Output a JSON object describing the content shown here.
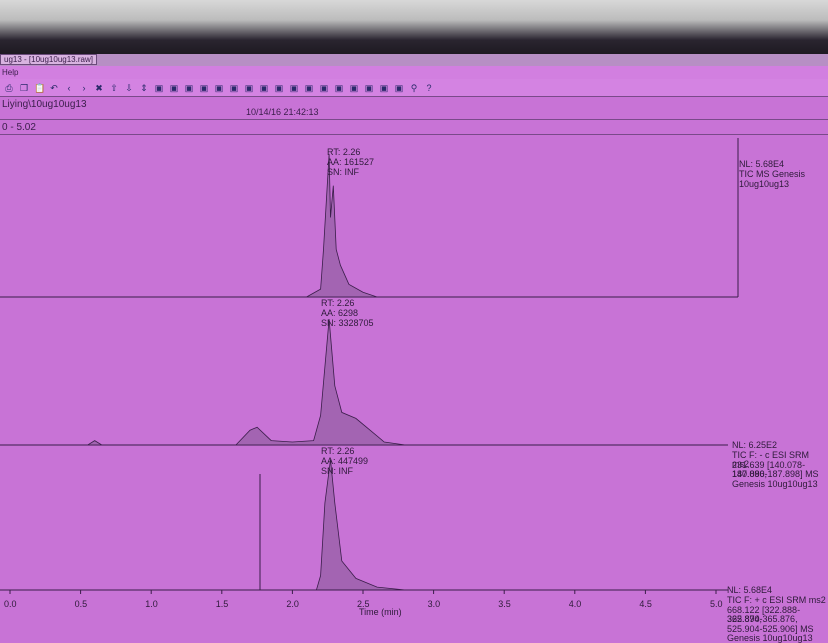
{
  "window": {
    "title": "ug13 - [10ug10ug13.raw]",
    "menu": "Help"
  },
  "toolbar_icons": [
    "print-icon",
    "copy-icon",
    "paste-icon",
    "undo-icon",
    "back-icon",
    "forward-icon",
    "zoom-fit-icon",
    "arrow-up-icon",
    "arrow-down-icon",
    "arrows-updown-icon",
    "display-icon",
    "display2-icon",
    "peak1-icon",
    "peak2-icon",
    "peak3-icon",
    "peak4-icon",
    "grid1-icon",
    "grid2-icon",
    "grid3-icon",
    "active-icon",
    "settings-icon",
    "chart1-icon",
    "chart2-icon",
    "chart3-icon",
    "chart4-icon",
    "spectrum1-icon",
    "spectrum2-icon",
    "pin-icon",
    "help-icon"
  ],
  "info": {
    "path": "Liying\\10ug10ug13",
    "datetime": "10/14/16 21:42:13",
    "range": "0 - 5.02"
  },
  "chart_data": {
    "type": "line",
    "xlabel": "Time (min)",
    "xlim": [
      0,
      5.0
    ],
    "xticks": [
      "0.0",
      "0.5",
      "1.0",
      "1.5",
      "2.0",
      "2.5",
      "3.0",
      "3.5",
      "4.0",
      "4.5",
      "5.0"
    ],
    "panels": [
      {
        "peak": {
          "rt": "RT: 2.26",
          "aa": "AA: 161527",
          "sn": "SN: INF"
        },
        "nl": "NL: 5.68E4",
        "desc": [
          "TIC  MS  Genesis",
          "10ug10ug13"
        ],
        "points": [
          [
            2.1,
            0
          ],
          [
            2.2,
            0.05
          ],
          [
            2.22,
            0.3
          ],
          [
            2.24,
            0.6
          ],
          [
            2.26,
            0.9
          ],
          [
            2.27,
            0.5
          ],
          [
            2.29,
            0.7
          ],
          [
            2.31,
            0.3
          ],
          [
            2.34,
            0.2
          ],
          [
            2.4,
            0.08
          ],
          [
            2.5,
            0.03
          ],
          [
            2.6,
            0
          ]
        ]
      },
      {
        "peak": {
          "rt": "RT: 2.26",
          "aa": "AA: 6298",
          "sn": "SN: 3328705"
        },
        "nl": "NL: 6.25E2",
        "desc": [
          "TIC F: - c ESI SRM ms2",
          "231.639 [140.078-140.080,",
          "187.896-187.898]  MS",
          "Genesis 10ug10ug13"
        ],
        "points": [
          [
            0,
            0
          ],
          [
            0.55,
            0
          ],
          [
            0.6,
            0.03
          ],
          [
            0.65,
            0
          ],
          [
            1.6,
            0
          ],
          [
            1.7,
            0.1
          ],
          [
            1.75,
            0.12
          ],
          [
            1.85,
            0.03
          ],
          [
            2.0,
            0.02
          ],
          [
            2.15,
            0.03
          ],
          [
            2.2,
            0.2
          ],
          [
            2.26,
            0.85
          ],
          [
            2.3,
            0.4
          ],
          [
            2.35,
            0.22
          ],
          [
            2.45,
            0.18
          ],
          [
            2.55,
            0.1
          ],
          [
            2.65,
            0.02
          ],
          [
            2.8,
            0
          ],
          [
            5.0,
            0
          ]
        ]
      },
      {
        "peak": {
          "rt": "RT: 2.26",
          "aa": "AA: 447499",
          "sn": "SN: INF"
        },
        "nl": "NL: 5.68E4",
        "desc": [
          "TIC F: + c ESI SRM ms2",
          "668.122 [322.888-322.890,",
          "365.874-365.876,",
          "525.904-525.906]  MS",
          "Genesis 10ug10ug13"
        ],
        "points": [
          [
            0,
            0
          ],
          [
            2.17,
            0
          ],
          [
            2.2,
            0.1
          ],
          [
            2.23,
            0.6
          ],
          [
            2.27,
            0.9
          ],
          [
            2.3,
            0.6
          ],
          [
            2.35,
            0.2
          ],
          [
            2.45,
            0.08
          ],
          [
            2.6,
            0.02
          ],
          [
            2.8,
            0
          ],
          [
            5.0,
            0
          ]
        ]
      }
    ]
  }
}
